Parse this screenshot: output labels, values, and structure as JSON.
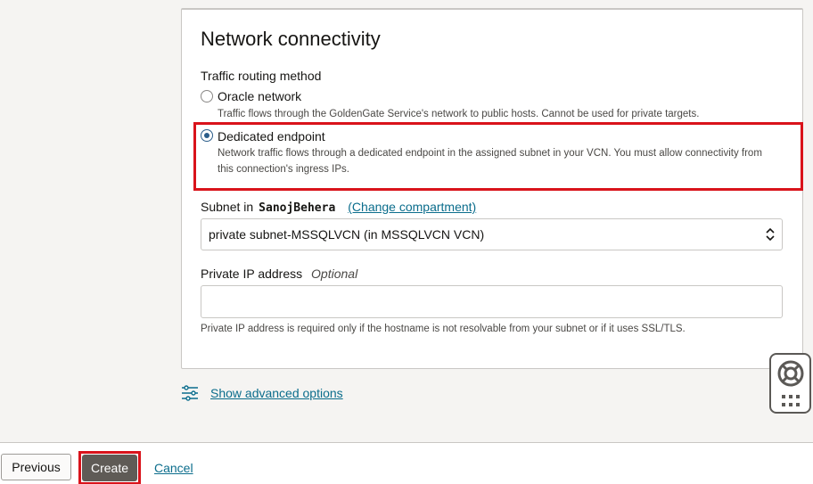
{
  "section": {
    "title": "Network connectivity",
    "traffic_routing_label": "Traffic routing method",
    "options": [
      {
        "label": "Oracle network",
        "description": "Traffic flows through the GoldenGate Service's network to public hosts. Cannot be used for private targets.",
        "selected": false
      },
      {
        "label": "Dedicated endpoint",
        "description_line1": "Network traffic flows through a dedicated endpoint in the assigned subnet in your VCN. You must allow connectivity from",
        "description_line2": "this connection's ingress IPs.",
        "selected": true
      }
    ],
    "subnet": {
      "label_prefix": "Subnet in",
      "compartment": "SanojBehera",
      "change_link": "(Change compartment)",
      "selected_value": "private subnet-MSSQLVCN (in MSSQLVCN VCN)"
    },
    "private_ip": {
      "label": "Private IP address",
      "optional": "Optional",
      "value": "",
      "help": "Private IP address is required only if the hostname is not resolvable from your subnet or if it uses SSL/TLS."
    }
  },
  "advanced_link": "Show advanced options",
  "footer": {
    "previous_label": "Previous",
    "create_label": "Create",
    "cancel_label": "Cancel"
  },
  "colors": {
    "highlight": "#d9131b",
    "link": "#0b6d8c",
    "radio_selected": "#2b5d8a",
    "create_button": "#5f5b56"
  },
  "icons": [
    "settings-sliders-icon",
    "lifebuoy-icon",
    "grid-dots-icon",
    "updown-chevron-icon"
  ]
}
